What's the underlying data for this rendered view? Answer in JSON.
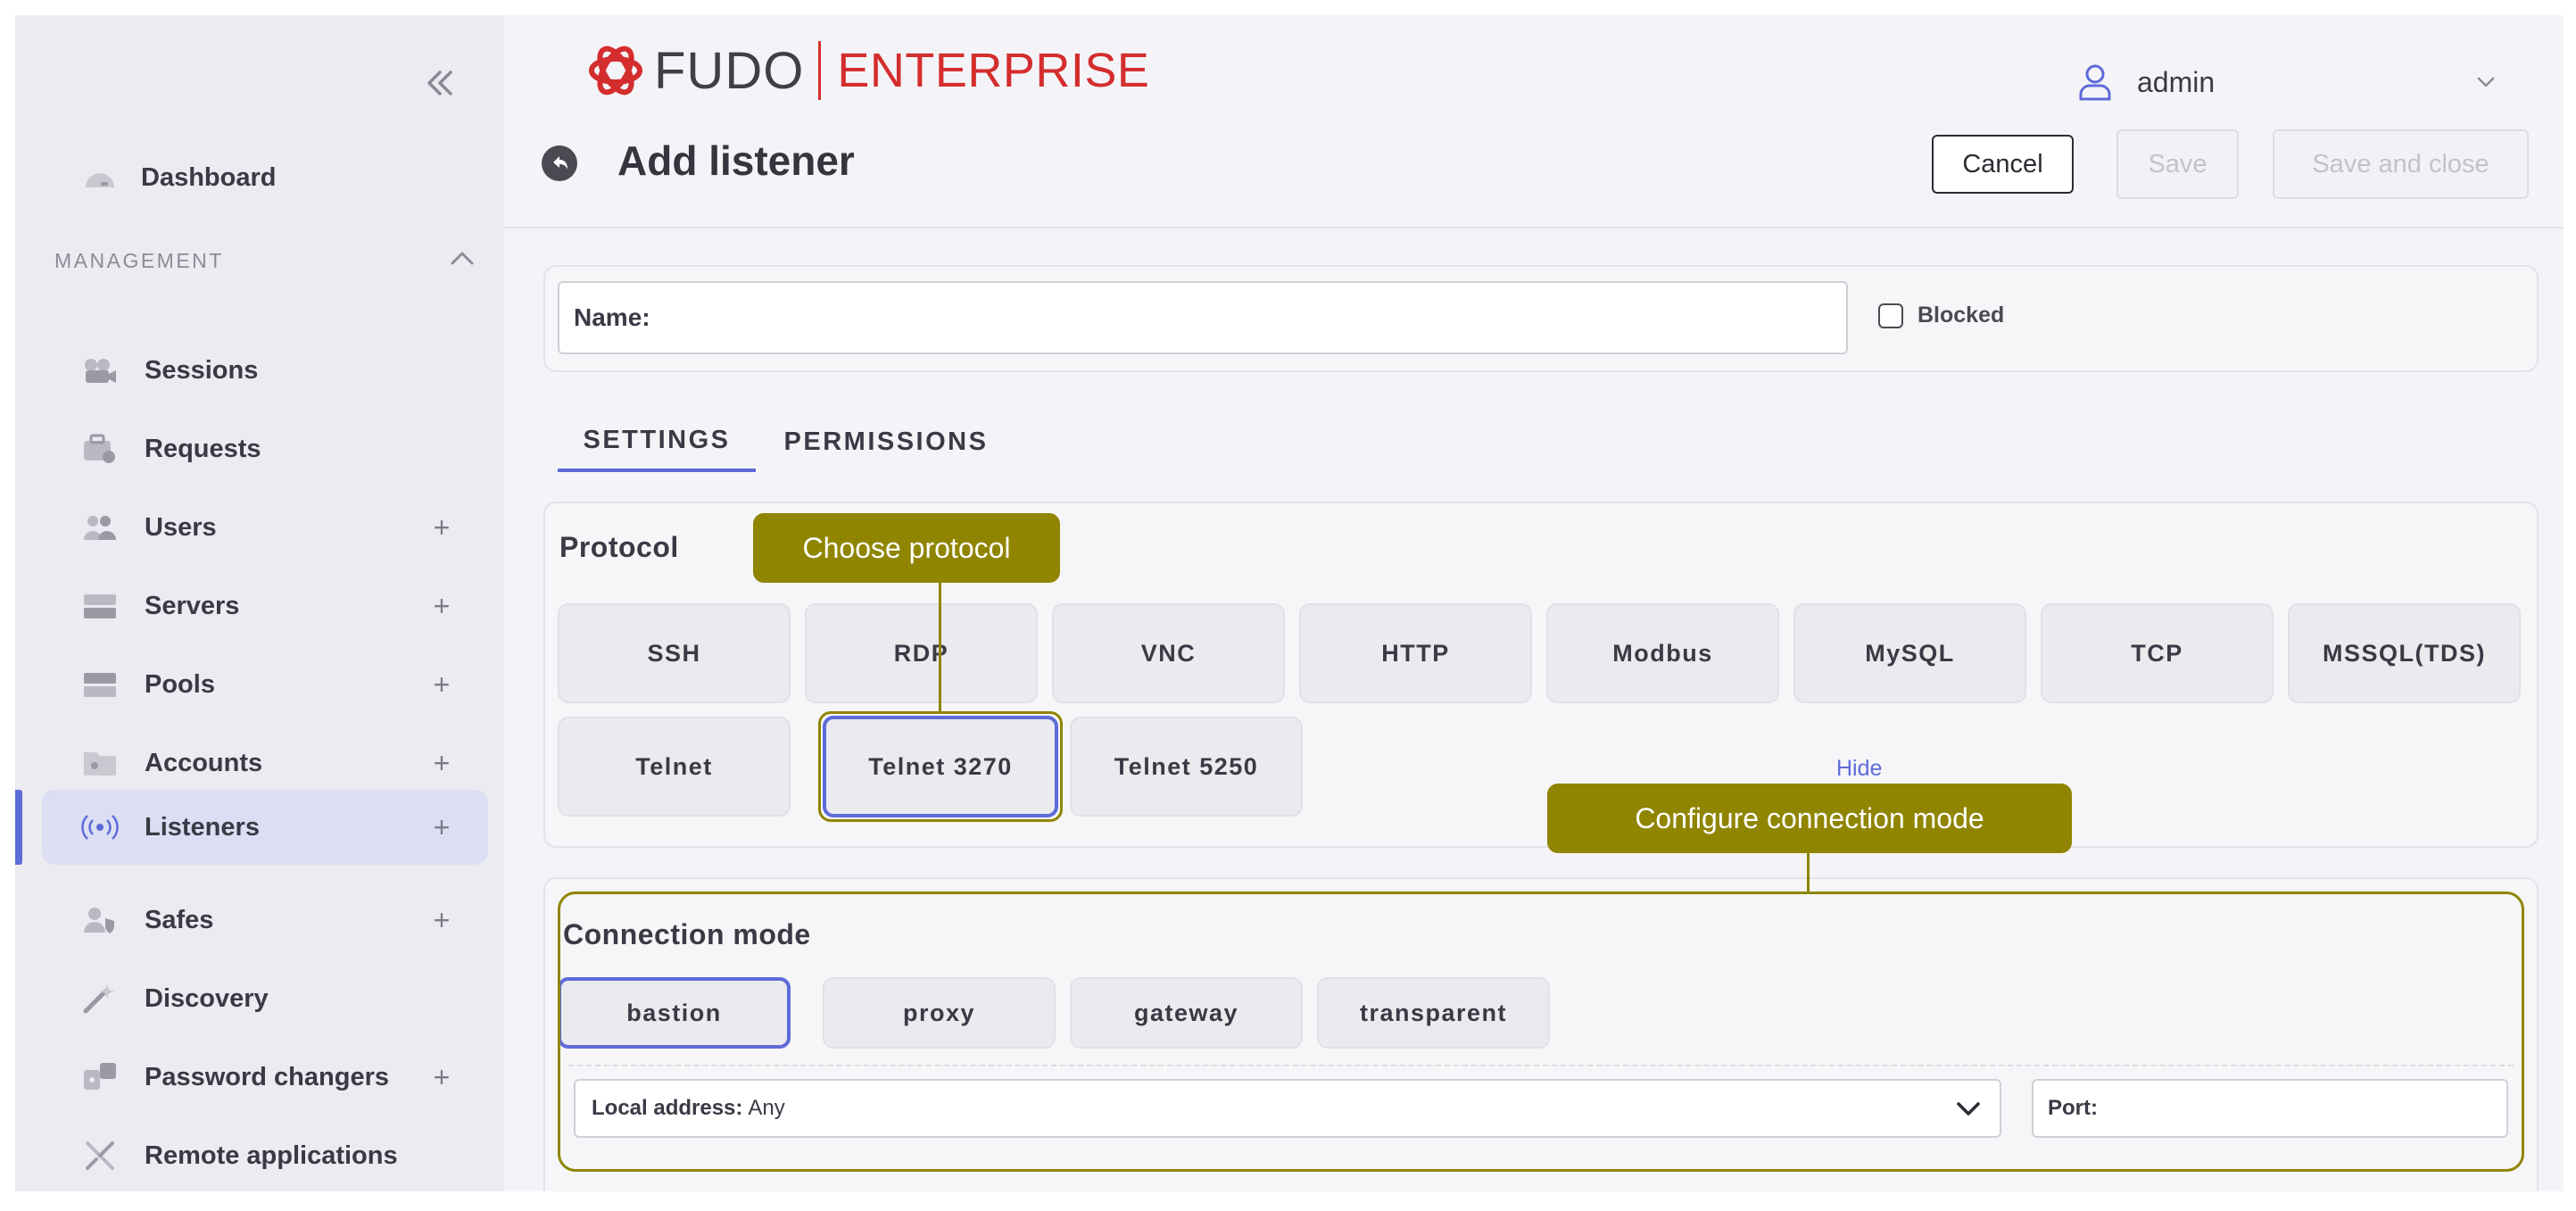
{
  "app": {
    "brand": "FUDO",
    "edition": "ENTERPRISE",
    "accent_color": "#d42d2d",
    "highlight_color": "#5e6bd8"
  },
  "user": {
    "name": "admin",
    "icon": "user-icon"
  },
  "sidebar": {
    "collapse_icon": "double-chevron-left-icon",
    "dashboard": {
      "label": "Dashboard",
      "icon": "dashboard-icon"
    },
    "section": {
      "label": "MANAGEMENT",
      "icon": "chevron-up-icon"
    },
    "items": [
      {
        "label": "Sessions",
        "icon": "sessions-icon",
        "plus": ""
      },
      {
        "label": "Requests",
        "icon": "requests-icon",
        "plus": ""
      },
      {
        "label": "Users",
        "icon": "users-icon",
        "plus": "+"
      },
      {
        "label": "Servers",
        "icon": "servers-icon",
        "plus": "+"
      },
      {
        "label": "Pools",
        "icon": "pools-icon",
        "plus": "+"
      },
      {
        "label": "Accounts",
        "icon": "accounts-icon",
        "plus": "+"
      },
      {
        "label": "Listeners",
        "icon": "listeners-icon",
        "plus": "+",
        "active": true
      },
      {
        "label": "Safes",
        "icon": "safes-icon",
        "plus": "+"
      },
      {
        "label": "Discovery",
        "icon": "discovery-icon",
        "plus": ""
      },
      {
        "label": "Password changers",
        "icon": "password-changers-icon",
        "plus": "+"
      },
      {
        "label": "Remote applications",
        "icon": "remote-applications-icon",
        "plus": ""
      }
    ]
  },
  "page": {
    "title": "Add listener",
    "back_icon": "back-arrow-icon",
    "buttons": {
      "cancel": "Cancel",
      "save": "Save",
      "save_close": "Save and close"
    }
  },
  "form": {
    "name_label": "Name:",
    "name_value": "",
    "blocked_label": "Blocked",
    "blocked_checked": false
  },
  "tabs": [
    {
      "label": "SETTINGS",
      "active": true
    },
    {
      "label": "PERMISSIONS",
      "active": false
    }
  ],
  "protocol": {
    "title": "Protocol",
    "options": [
      "SSH",
      "RDP",
      "VNC",
      "HTTP",
      "Modbus",
      "MySQL",
      "TCP",
      "MSSQL(TDS)",
      "Telnet",
      "Telnet 3270",
      "Telnet 5250"
    ],
    "selected": "Telnet 3270",
    "hide_link": "Hide"
  },
  "connection": {
    "title": "Connection mode",
    "modes": [
      "bastion",
      "proxy",
      "gateway",
      "transparent"
    ],
    "selected": "bastion",
    "local_address_label": "Local address:",
    "local_address_value": "Any",
    "port_label": "Port:",
    "port_value": ""
  },
  "annotations": {
    "color": "#8f8500",
    "choose_protocol": "Choose protocol",
    "configure_connection": "Configure connection mode"
  }
}
